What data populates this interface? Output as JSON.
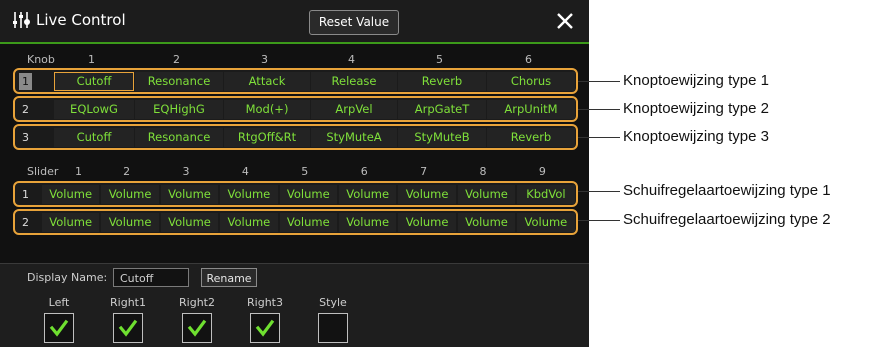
{
  "window": {
    "title": "Live Control",
    "reset_label": "Reset Value"
  },
  "knob": {
    "header_label": "Knob",
    "columns": [
      "1",
      "2",
      "3",
      "4",
      "5",
      "6"
    ],
    "rows": [
      {
        "num": "1",
        "cells": [
          "Cutoff",
          "Resonance",
          "Attack",
          "Release",
          "Reverb",
          "Chorus"
        ]
      },
      {
        "num": "2",
        "cells": [
          "EQLowG",
          "EQHighG",
          "Mod(+)",
          "ArpVel",
          "ArpGateT",
          "ArpUnitM"
        ]
      },
      {
        "num": "3",
        "cells": [
          "Cutoff",
          "Resonance",
          "RtgOff&Rt",
          "StyMuteA",
          "StyMuteB",
          "Reverb"
        ]
      }
    ]
  },
  "slider": {
    "header_label": "Slider",
    "columns": [
      "1",
      "2",
      "3",
      "4",
      "5",
      "6",
      "7",
      "8",
      "9"
    ],
    "rows": [
      {
        "num": "1",
        "cells": [
          "Volume",
          "Volume",
          "Volume",
          "Volume",
          "Volume",
          "Volume",
          "Volume",
          "Volume",
          "KbdVol"
        ]
      },
      {
        "num": "2",
        "cells": [
          "Volume",
          "Volume",
          "Volume",
          "Volume",
          "Volume",
          "Volume",
          "Volume",
          "Volume",
          "Volume"
        ]
      }
    ]
  },
  "display_name": {
    "label": "Display Name:",
    "value": "Cutoff",
    "rename_label": "Rename"
  },
  "checkboxes": [
    {
      "label": "Left",
      "checked": true
    },
    {
      "label": "Right1",
      "checked": true
    },
    {
      "label": "Right2",
      "checked": true
    },
    {
      "label": "Right3",
      "checked": true
    },
    {
      "label": "Style",
      "checked": false
    }
  ],
  "annotations": [
    "Knoptoewijzing type 1",
    "Knoptoewijzing type 2",
    "Knoptoewijzing type 3",
    "Schuifregelaartoewijzing type 1",
    "Schuifregelaartoewijzing type 2"
  ],
  "colors": {
    "accent_orange": "#e8a33a",
    "value_green": "#7fe03a",
    "title_underline": "#3c9a1a",
    "check_green": "#6fe030"
  }
}
